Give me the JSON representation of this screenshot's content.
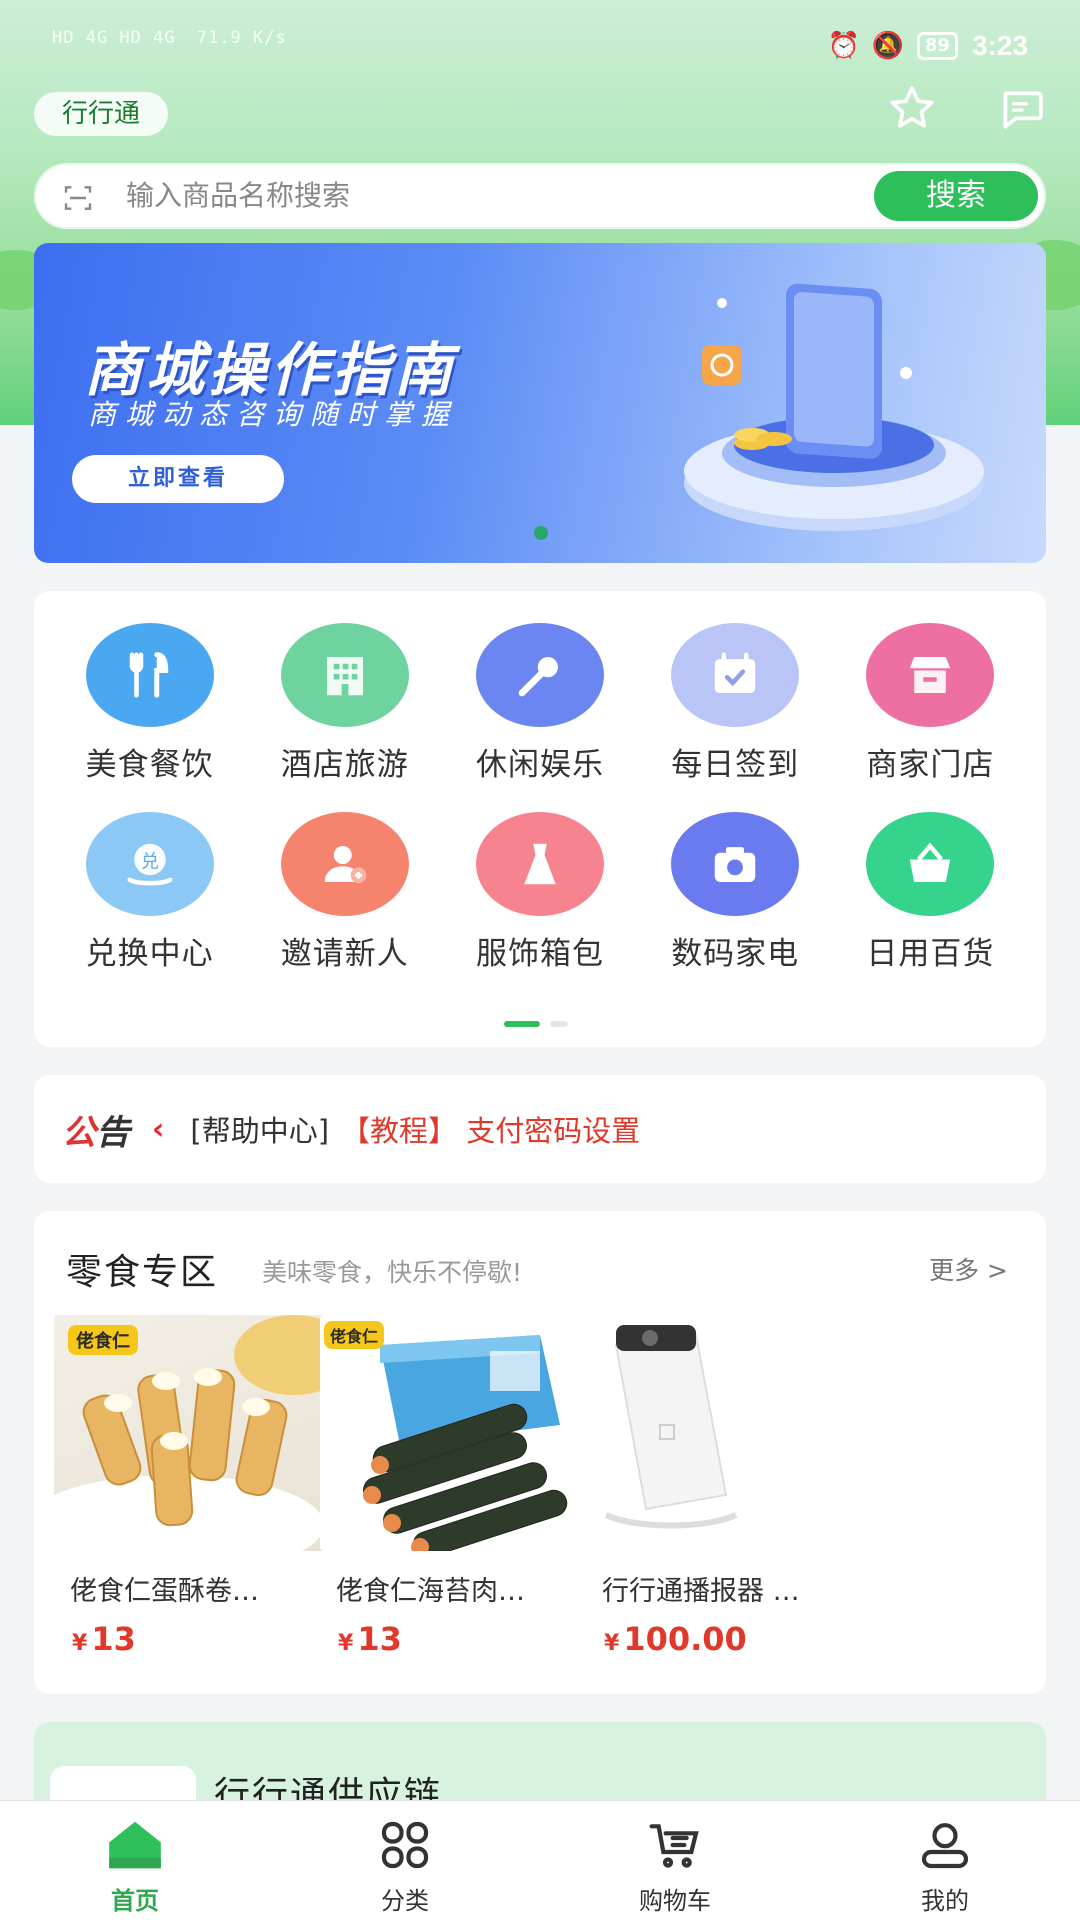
{
  "status_bar": {
    "network_left": "HD 4G HD 4G",
    "speed": "71.9 K/s",
    "battery": "89",
    "time": "3:23"
  },
  "header": {
    "app_name": "行行通"
  },
  "search": {
    "placeholder": "输入商品名称搜索",
    "button": "搜索"
  },
  "banner": {
    "title": "商城操作指南",
    "subtitle": "商城动态咨询随时掌握",
    "cta": "立即查看"
  },
  "categories": [
    {
      "label": "美食餐饮",
      "icon": "fork-knife-icon",
      "color": "#4aa8f0"
    },
    {
      "label": "酒店旅游",
      "icon": "building-icon",
      "color": "#6fd3a0"
    },
    {
      "label": "休闲娱乐",
      "icon": "microphone-icon",
      "color": "#6b86f0"
    },
    {
      "label": "每日签到",
      "icon": "calendar-check-icon",
      "color": "#b9c5f6"
    },
    {
      "label": "商家门店",
      "icon": "store-icon",
      "color": "#ee6fa2"
    },
    {
      "label": "兑换中心",
      "icon": "exchange-icon",
      "color": "#8cc8f6"
    },
    {
      "label": "邀请新人",
      "icon": "add-user-icon",
      "color": "#f5836e"
    },
    {
      "label": "服饰箱包",
      "icon": "dress-icon",
      "color": "#f7838e"
    },
    {
      "label": "数码家电",
      "icon": "camera-icon",
      "color": "#6a7bf0"
    },
    {
      "label": "日用百货",
      "icon": "basket-icon",
      "color": "#35d38c"
    }
  ],
  "notice": {
    "label_a": "公",
    "label_b": "告",
    "category": "[帮助中心]",
    "text": "【教程】 支付密码设置"
  },
  "snacks": {
    "title": "零食专区",
    "subtitle": "美味零食，快乐不停歇!",
    "more": "更多 >",
    "products": [
      {
        "name": "佬食仁蛋酥卷…",
        "currency": "¥",
        "price": "13",
        "brand": "佬食仁"
      },
      {
        "name": "佬食仁海苔肉…",
        "currency": "¥",
        "price": "13",
        "brand": "佬食仁"
      },
      {
        "name": "行行通播报器 …",
        "currency": "¥",
        "price": "100.00"
      }
    ]
  },
  "supply": {
    "title": "行行通供应链"
  },
  "tabbar": [
    {
      "label": "首页",
      "icon": "home-icon",
      "active": true
    },
    {
      "label": "分类",
      "icon": "category-grid-icon",
      "active": false
    },
    {
      "label": "购物车",
      "icon": "cart-icon",
      "active": false
    },
    {
      "label": "我的",
      "icon": "user-icon",
      "active": false
    }
  ],
  "colors": {
    "accent": "#2fbf5a",
    "price": "#e0392b"
  }
}
